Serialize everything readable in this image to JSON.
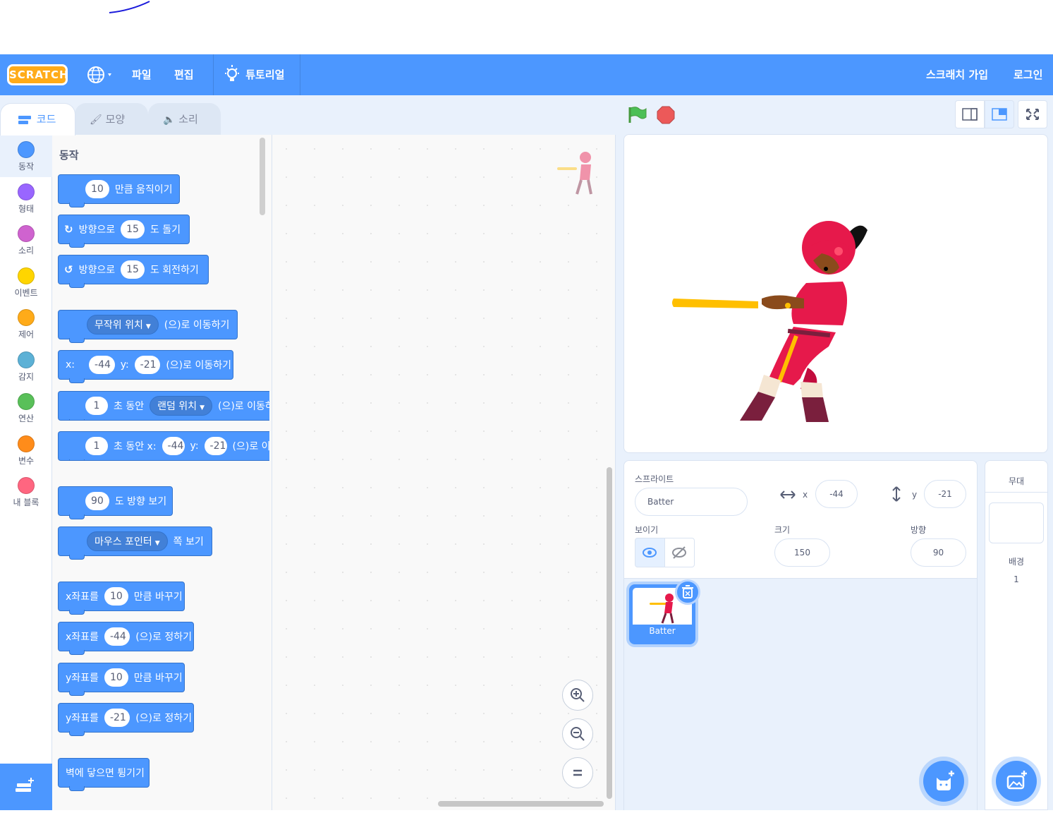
{
  "menu": {
    "logo": "SCRATCH",
    "file": "파일",
    "edit": "편집",
    "tutorials": "튜토리얼",
    "join": "스크래치 가입",
    "signin": "로그인"
  },
  "tabs": {
    "code": "코드",
    "costumes": "모양",
    "sounds": "소리"
  },
  "categories": [
    {
      "label": "동작",
      "color": "#4c97ff"
    },
    {
      "label": "형태",
      "color": "#9966ff"
    },
    {
      "label": "소리",
      "color": "#cf63cf"
    },
    {
      "label": "이벤트",
      "color": "#ffd500"
    },
    {
      "label": "제어",
      "color": "#ffab19"
    },
    {
      "label": "감지",
      "color": "#5cb1d6"
    },
    {
      "label": "연산",
      "color": "#59c059"
    },
    {
      "label": "변수",
      "color": "#ff8c1a"
    },
    {
      "label": "내 블록",
      "color": "#ff6680"
    }
  ],
  "palette": {
    "title": "동작",
    "b1": {
      "val": "10",
      "text": "만큼 움직이기"
    },
    "b2": {
      "pre": "방향으로",
      "val": "15",
      "text": "도 돌기"
    },
    "b3": {
      "pre": "방향으로",
      "val": "15",
      "text": "도 회전하기"
    },
    "b4": {
      "dd": "무작위 위치",
      "text": "(으)로 이동하기"
    },
    "b5": {
      "x": "x:",
      "xv": "-44",
      "y": "y:",
      "yv": "-21",
      "text": "(으)로 이동하기"
    },
    "b6": {
      "val": "1",
      "mid": "초 동안",
      "dd": "랜덤 위치",
      "text": "(으)로 이동하기"
    },
    "b7": {
      "val": "1",
      "mid": "초 동안 x:",
      "xv": "-44",
      "y": "y:",
      "yv": "-21",
      "text": "(으)로 이동하기"
    },
    "b8": {
      "val": "90",
      "text": "도 방향 보기"
    },
    "b9": {
      "dd": "마우스 포인터",
      "text": "쪽 보기"
    },
    "b10": {
      "pre": "x좌표를",
      "val": "10",
      "text": "만큼 바꾸기"
    },
    "b11": {
      "pre": "x좌표를",
      "val": "-44",
      "text": "(으)로 정하기"
    },
    "b12": {
      "pre": "y좌표를",
      "val": "10",
      "text": "만큼 바꾸기"
    },
    "b13": {
      "pre": "y좌표를",
      "val": "-21",
      "text": "(으)로 정하기"
    },
    "b14": {
      "text": "벽에 닿으면 튕기기"
    }
  },
  "sprite_info": {
    "sprite_label": "스프라이트",
    "name": "Batter",
    "x_label": "x",
    "x": "-44",
    "y_label": "y",
    "y": "-21",
    "show_label": "보이기",
    "size_label": "크기",
    "size": "150",
    "direction_label": "방향",
    "direction": "90"
  },
  "sprites": [
    {
      "name": "Batter"
    }
  ],
  "stage_pane": {
    "title": "무대",
    "backdrops_label": "배경",
    "backdrops_count": "1"
  }
}
